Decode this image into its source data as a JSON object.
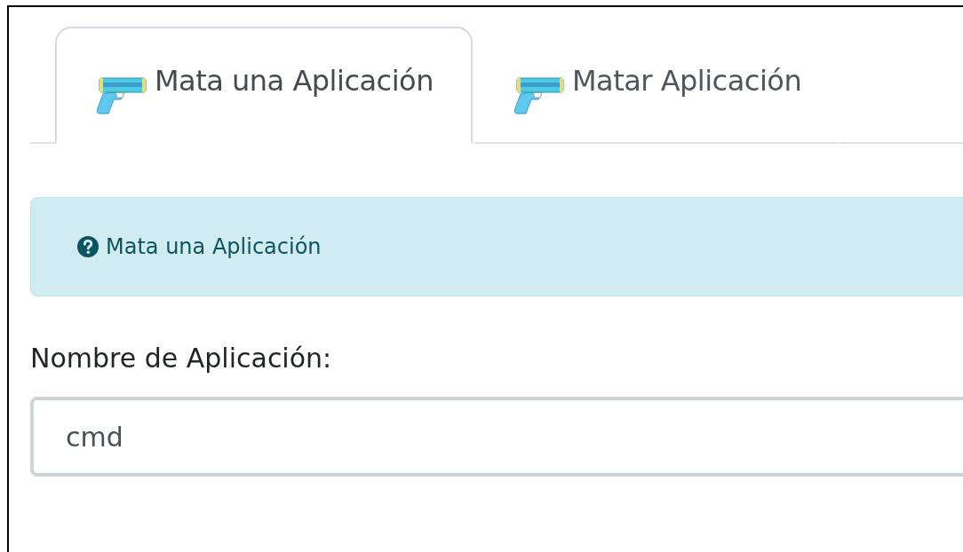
{
  "tabs": [
    {
      "label": "Mata una Aplicación",
      "selected": true
    },
    {
      "label": "Matar Aplicación",
      "selected": false
    }
  ],
  "alert": {
    "text": "Mata una Aplicación"
  },
  "field": {
    "label": "Nombre de Aplicación:",
    "value": "cmd"
  }
}
